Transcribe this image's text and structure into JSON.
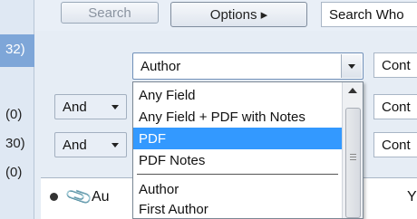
{
  "toolbar": {
    "search_label": "Search",
    "options_label": "Options ▸",
    "search_whole_label": "Search Who"
  },
  "sidebar": {
    "counts": [
      "32)",
      "(0)",
      "30)",
      "(0)"
    ]
  },
  "conditions": {
    "field_value": "Author",
    "rows": [
      {
        "operator": "And",
        "cont_label": "Cont"
      },
      {
        "operator": "And",
        "cont_label": "Cont"
      }
    ],
    "cont_top_label": "Cont"
  },
  "dropdown": {
    "items": [
      "Any Field",
      "Any Field + PDF with Notes",
      "PDF",
      "PDF Notes",
      "Author",
      "First Author"
    ],
    "selected": "PDF"
  },
  "table": {
    "col_author_fragment": "Au",
    "col_y_fragment": "Y"
  }
}
